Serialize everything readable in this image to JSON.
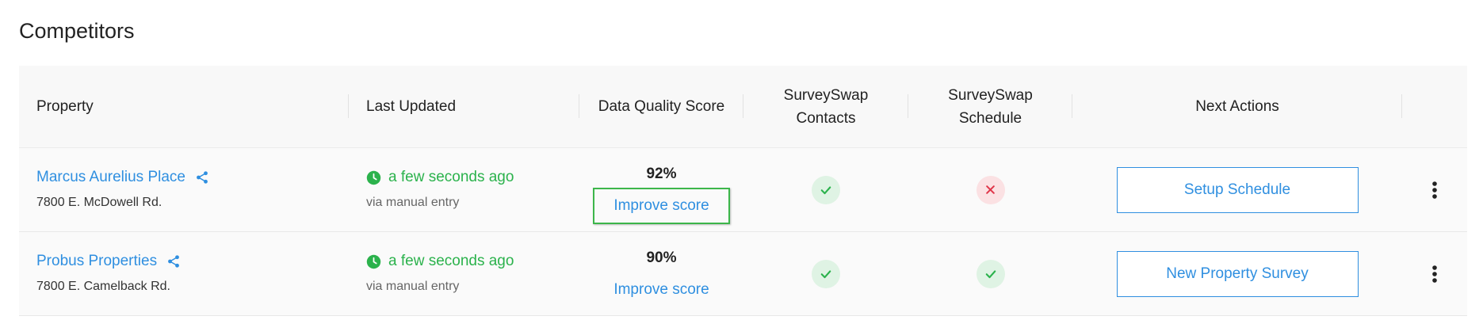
{
  "page": {
    "title": "Competitors"
  },
  "table": {
    "headers": {
      "property": "Property",
      "last_updated": "Last Updated",
      "data_quality": "Data Quality Score",
      "contacts_line1": "SurveySwap",
      "contacts_line2": "Contacts",
      "schedule_line1": "SurveySwap",
      "schedule_line2": "Schedule",
      "next_actions": "Next Actions"
    },
    "rows": [
      {
        "name": "Marcus Aurelius Place",
        "address": "7800 E. McDowell Rd.",
        "updated": "a few seconds ago",
        "via": "via manual entry",
        "score": "92%",
        "improve": "Improve score",
        "contacts_status": "check",
        "schedule_status": "cross",
        "action": "Setup Schedule"
      },
      {
        "name": "Probus Properties",
        "address": "7800 E. Camelback Rd.",
        "updated": "a few seconds ago",
        "via": "via manual entry",
        "score": "90%",
        "improve": "Improve score",
        "contacts_status": "check",
        "schedule_status": "check",
        "action": "New Property Survey"
      }
    ]
  },
  "colors": {
    "link": "#2f8fe0",
    "success": "#2bb24c",
    "danger": "#e0364a",
    "focus_outline": "#3cb64a"
  },
  "icons": {
    "share": "share-icon",
    "clock": "clock-icon",
    "check": "check-icon",
    "cross": "close-icon",
    "more": "more-vertical-icon"
  }
}
